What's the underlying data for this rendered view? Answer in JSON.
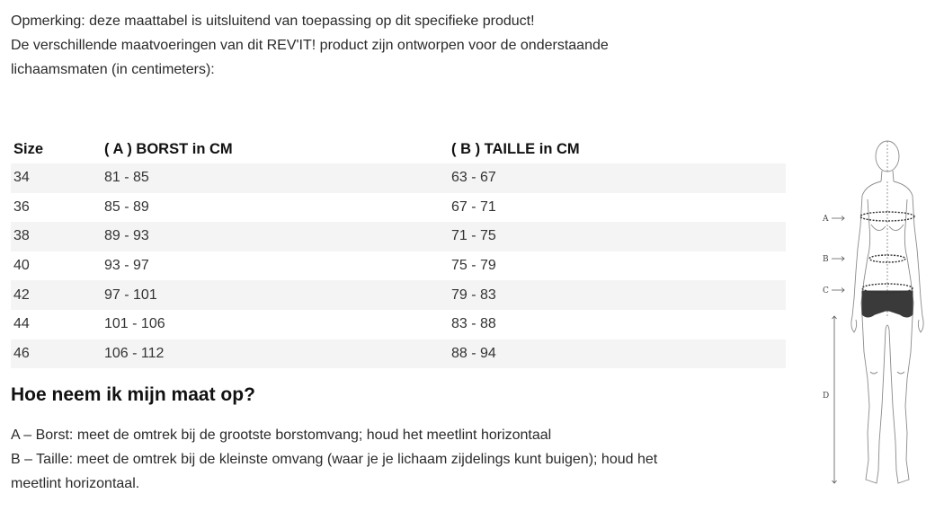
{
  "note": {
    "line1": "Opmerking: deze maattabel is uitsluitend van toepassing op dit specifieke product!",
    "line2": "De verschillende maatvoeringen van dit REV'IT! product zijn ontworpen voor de onderstaande",
    "line3": "lichaamsmaten (in centimeters):"
  },
  "table": {
    "headers": [
      "Size",
      "( A ) BORST in CM",
      "( B ) TAILLE in CM"
    ],
    "rows": [
      [
        "34",
        "81 - 85",
        "63 - 67"
      ],
      [
        "36",
        "85 - 89",
        "67 - 71"
      ],
      [
        "38",
        "89 - 93",
        "71 - 75"
      ],
      [
        "40",
        "93 - 97",
        "75 - 79"
      ],
      [
        "42",
        "97 - 101",
        "79 - 83"
      ],
      [
        "44",
        "101 - 106",
        "83 - 88"
      ],
      [
        "46",
        "106 - 112",
        "88 - 94"
      ]
    ]
  },
  "howto": {
    "title": "Hoe neem ik mijn maat op?",
    "line_a": "A – Borst: meet de omtrek bij de grootste borstomvang; houd het meetlint horizontaal",
    "line_b1": "B – Taille: meet de omtrek bij de kleinste omvang (waar je je lichaam zijdelings kunt buigen); houd het",
    "line_b2": "meetlint horizontaal."
  },
  "figure": {
    "label_a": "A",
    "label_b": "B",
    "label_c": "C",
    "label_d": "D"
  }
}
